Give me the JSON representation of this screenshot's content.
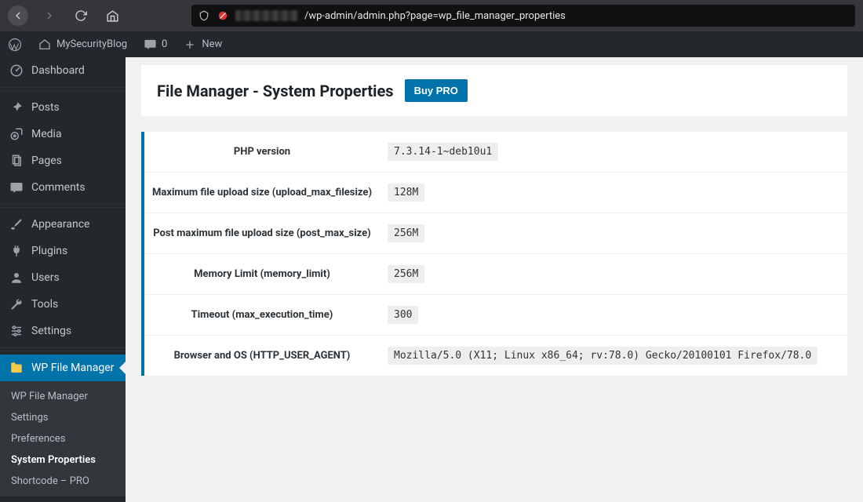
{
  "browser": {
    "url_path": "/wp-admin/admin.php?page=wp_file_manager_properties"
  },
  "adminbar": {
    "site_name": "MySecurityBlog",
    "comments_count": "0",
    "new_label": "New"
  },
  "sidebar": {
    "items": {
      "dashboard": "Dashboard",
      "posts": "Posts",
      "media": "Media",
      "pages": "Pages",
      "comments": "Comments",
      "appearance": "Appearance",
      "plugins": "Plugins",
      "users": "Users",
      "tools": "Tools",
      "settings": "Settings",
      "wp_file_manager": "WP File Manager"
    },
    "submenu": {
      "wpfm": "WP File Manager",
      "settings": "Settings",
      "preferences": "Preferences",
      "system_properties": "System Properties",
      "shortcode_pro": "Shortcode – PRO"
    }
  },
  "page": {
    "title": "File Manager - System Properties",
    "buy_pro": "Buy PRO"
  },
  "properties": {
    "php_version": {
      "label": "PHP version",
      "value": "7.3.14-1~deb10u1"
    },
    "upload_max": {
      "label": "Maximum file upload size (upload_max_filesize)",
      "value": "128M"
    },
    "post_max": {
      "label": "Post maximum file upload size (post_max_size)",
      "value": "256M"
    },
    "memory_limit": {
      "label": "Memory Limit (memory_limit)",
      "value": "256M"
    },
    "timeout": {
      "label": "Timeout (max_execution_time)",
      "value": "300"
    },
    "user_agent": {
      "label": "Browser and OS (HTTP_USER_AGENT)",
      "value": "Mozilla/5.0 (X11; Linux x86_64; rv:78.0) Gecko/20100101 Firefox/78.0"
    }
  },
  "colors": {
    "wp_blue": "#0073aa",
    "sidebar_bg": "#23282d"
  }
}
